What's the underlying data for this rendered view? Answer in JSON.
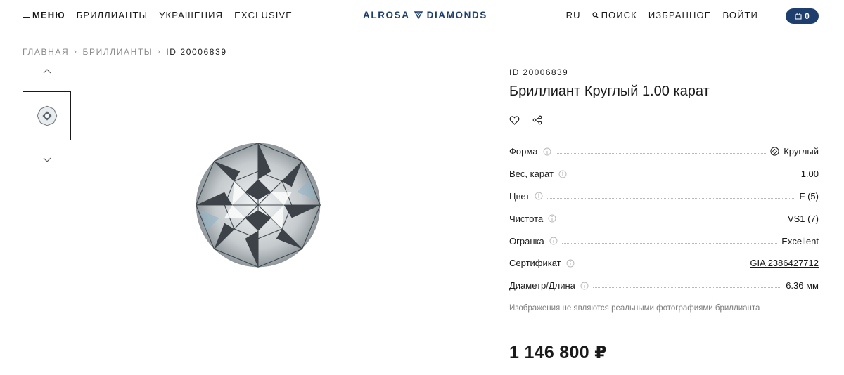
{
  "header": {
    "menu_label": "МЕНЮ",
    "nav": [
      "БРИЛЛИАНТЫ",
      "УКРАШЕНИЯ",
      "EXCLUSIVE"
    ],
    "logo_left": "ALROSA",
    "logo_right": "DIAMONDS",
    "lang": "RU",
    "search_label": "ПОИСК",
    "favorites_label": "ИЗБРАННОЕ",
    "login_label": "ВОЙТИ",
    "cart_count": "0",
    "brand_color": "#1e3f6e"
  },
  "breadcrumb": [
    "ГЛАВНАЯ",
    "БРИЛЛИАНТЫ",
    "ID 20006839"
  ],
  "product": {
    "id_label": "ID 20006839",
    "title": "Бриллиант Круглый 1.00 карат",
    "specs": [
      {
        "label": "Форма",
        "value": "Круглый",
        "icon": "round-shape-icon"
      },
      {
        "label": "Вес, карат",
        "value": "1.00"
      },
      {
        "label": "Цвет",
        "value": "F (5)"
      },
      {
        "label": "Чистота",
        "value": "VS1 (7)"
      },
      {
        "label": "Огранка",
        "value": "Excellent"
      },
      {
        "label": "Сертификат",
        "value": "GIA 2386427712",
        "link": true
      },
      {
        "label": "Диаметр/Длина",
        "value": "6.36 мм"
      }
    ],
    "disclaimer": "Изображения не являются реальными фотографиями бриллианта",
    "price": "1 146 800 ₽"
  }
}
